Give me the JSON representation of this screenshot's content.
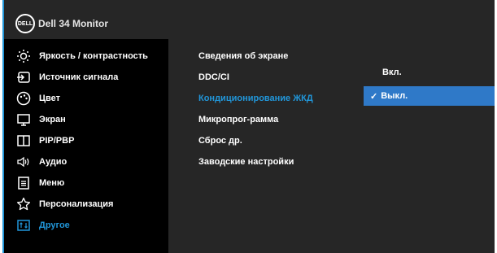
{
  "header": {
    "brand": "DELL",
    "title": "Dell  34 Monitor"
  },
  "menu": {
    "items": [
      {
        "label": "Яркость / контрастность",
        "icon": "brightness-icon"
      },
      {
        "label": "Источник сигнала",
        "icon": "input-source-icon"
      },
      {
        "label": "Цвет",
        "icon": "color-icon"
      },
      {
        "label": "Экран",
        "icon": "display-icon"
      },
      {
        "label": "PIP/PBP",
        "icon": "pip-icon"
      },
      {
        "label": "Аудио",
        "icon": "audio-icon"
      },
      {
        "label": "Меню",
        "icon": "menu-icon"
      },
      {
        "label": "Персонализация",
        "icon": "star-icon"
      },
      {
        "label": "Другое",
        "icon": "other-icon"
      }
    ],
    "active_index": 8
  },
  "submenu": {
    "items": [
      "Сведения об экране",
      "DDC/CI",
      "Кондиционирование ЖКД",
      "Микропрог-рамма",
      "Сброс др.",
      "Заводские настройки"
    ],
    "active_index": 2
  },
  "values": {
    "ddc_ci": "Вкл.",
    "lcd_conditioning": "Выкл.",
    "checkmark": "✓"
  },
  "colors": {
    "accent": "#2196d9",
    "selected": "#2f79c8"
  }
}
